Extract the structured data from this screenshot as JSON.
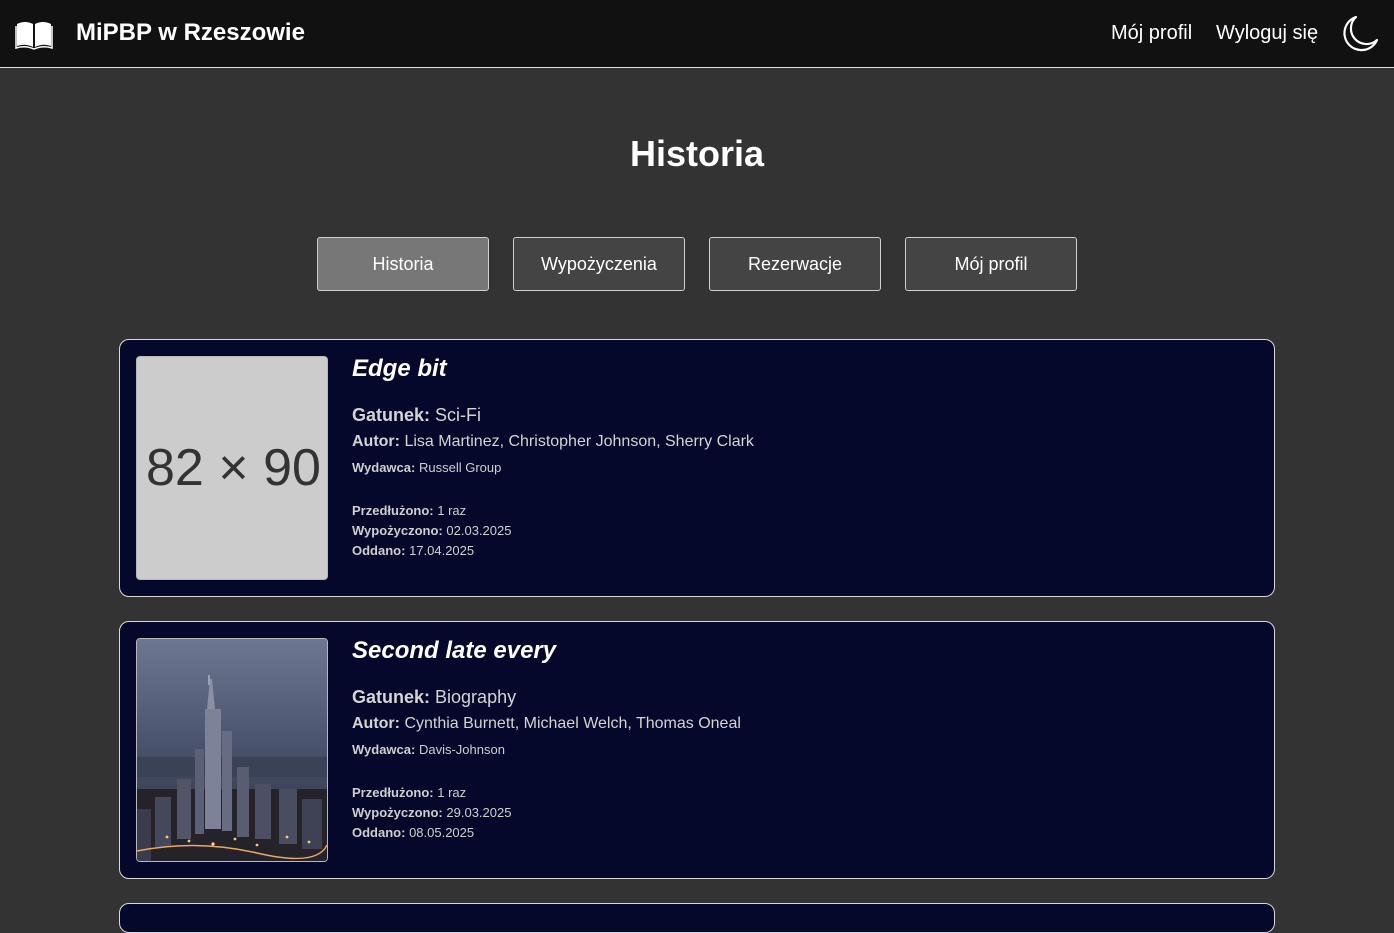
{
  "app": {
    "brand_name": "MiPBP w Rzeszowie",
    "brand_icon": "open-book-icon",
    "theme_icon": "moon-icon"
  },
  "nav": {
    "profile_label": "Mój profil",
    "logout_label": "Wyloguj się"
  },
  "page": {
    "title": "Historia"
  },
  "tabs": [
    {
      "label": "Historia",
      "active": true
    },
    {
      "label": "Wypożyczenia",
      "active": false
    },
    {
      "label": "Rezerwacje",
      "active": false
    },
    {
      "label": "Mój profil",
      "active": false
    }
  ],
  "labels": {
    "genre": "Gatunek:",
    "author": "Autor:",
    "publisher": "Wydawca:",
    "extended": "Przedłużono:",
    "borrowed": "Wypożyczono:",
    "returned": "Oddano:"
  },
  "history": [
    {
      "title": "Edge bit",
      "cover_text": "82 × 90",
      "genre": "Sci-Fi",
      "authors": "Lisa Martinez, Christopher Johnson, Sherry Clark",
      "publisher": "Russell Group",
      "extended": "1 raz",
      "borrowed": "02.03.2025",
      "returned": "17.04.2025"
    },
    {
      "title": "Second late every",
      "cover_description": "city-skyline-night-photo",
      "genre": "Biography",
      "authors": "Cynthia Burnett, Michael Welch, Thomas Oneal",
      "publisher": "Davis-Johnson",
      "extended": "1 raz",
      "borrowed": "29.03.2025",
      "returned": "08.05.2025"
    }
  ],
  "colors": {
    "page_bg": "#333333",
    "navbar_bg": "#111111",
    "card_bg": "#05082a",
    "tab_bg": "#444444",
    "tab_active_bg": "#777777"
  }
}
